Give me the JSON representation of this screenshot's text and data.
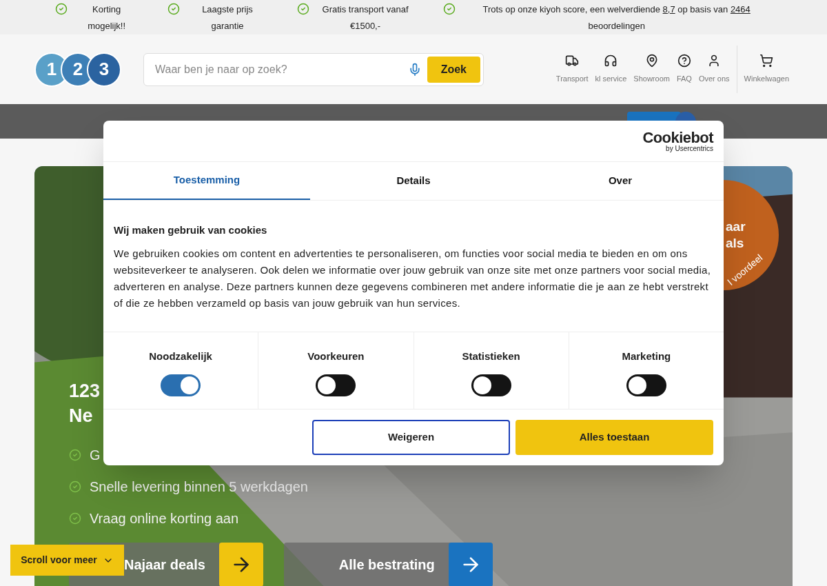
{
  "usp_bar": [
    {
      "text": "Korting mogelijk!!"
    },
    {
      "text": "Laagste prijs garantie"
    },
    {
      "text": "Gratis transport vanaf €1500,-"
    },
    {
      "segments": [
        {
          "text": "Trots op onze kiyoh score, een welverdiende ",
          "underline": false
        },
        {
          "text": "8,7",
          "underline": true
        },
        {
          "text": " op basis van ",
          "underline": false
        },
        {
          "text": "2464",
          "underline": true
        },
        {
          "text": " beoordelingen",
          "underline": false
        }
      ]
    }
  ],
  "logo": {
    "digits": [
      "1",
      "2",
      "3"
    ]
  },
  "search": {
    "placeholder": "Waar ben je naar op zoek?",
    "button": "Zoek"
  },
  "header_links": [
    {
      "kind": "truck",
      "label": "Transport"
    },
    {
      "kind": "headset",
      "label": "kl service"
    },
    {
      "kind": "pin",
      "label": "Showroom"
    },
    {
      "kind": "help",
      "label": "FAQ"
    },
    {
      "kind": "user",
      "label": "Over ons"
    },
    {
      "kind": "cart",
      "label": "Winkelwagen"
    }
  ],
  "hero": {
    "title_lines": [
      "123",
      "Ne"
    ],
    "bullets": [
      "G",
      "Snelle levering binnen 5 werkdagen",
      "Vraag online korting aan"
    ],
    "badge_lines": [
      "aar",
      "als"
    ],
    "badge_arc": "l voordeel",
    "buttons": [
      {
        "label": "Najaar deals",
        "kind": "yellow"
      },
      {
        "label": "Alle bestrating",
        "kind": "blue"
      }
    ]
  },
  "scroll_button": "Scroll voor meer",
  "cookie_dialog": {
    "brand": "Cookiebot",
    "brand_sub": "by Usercentrics",
    "tabs": [
      {
        "label": "Toestemming",
        "selected": true
      },
      {
        "label": "Details",
        "selected": false
      },
      {
        "label": "Over",
        "selected": false
      }
    ],
    "heading": "Wij maken gebruik van cookies",
    "body": "We gebruiken cookies om content en advertenties te personaliseren, om functies voor social media te bieden en om ons websiteverkeer te analyseren. Ook delen we informatie over jouw gebruik van onze site met onze partners voor social media, adverteren en analyse. Deze partners kunnen deze gegevens combineren met andere informatie die je aan ze hebt verstrekt of die ze hebben verzameld op basis van jouw gebruik van hun services.",
    "categories": [
      {
        "label": "Noodzakelijk",
        "on": true
      },
      {
        "label": "Voorkeuren",
        "on": false
      },
      {
        "label": "Statistieken",
        "on": false
      },
      {
        "label": "Marketing",
        "on": false
      }
    ],
    "buttons": [
      {
        "label": "Weigeren",
        "kind": "outline"
      },
      {
        "label": "Alles toestaan",
        "kind": "primary"
      }
    ]
  }
}
